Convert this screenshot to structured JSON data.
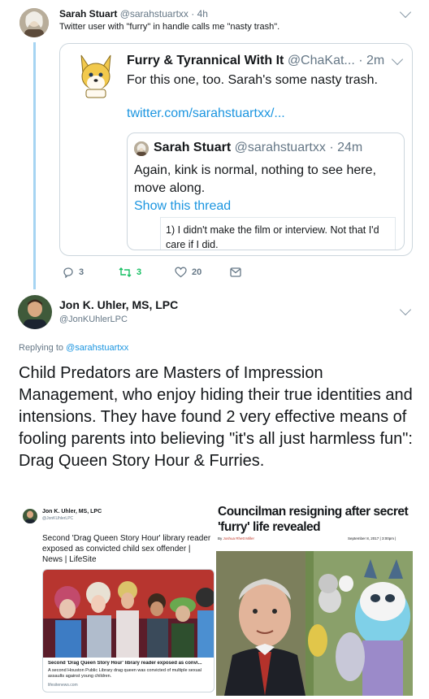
{
  "tweet1": {
    "name": "Sarah Stuart",
    "handle": "@sarahstuartxx",
    "time": "· 4h",
    "text": "Twitter user with \"furry\" in handle calls me \"nasty trash\"."
  },
  "quote": {
    "name": "Furry & Tyrannical With It",
    "handle": "@ChaKat...",
    "time": "· 2m",
    "text": "For this one, too. Sarah's some nasty trash.",
    "link": "twitter.com/sarahstuartxx/..."
  },
  "inner_quote": {
    "name": "Sarah Stuart",
    "handle": "@sarahstuartxx",
    "time": "· 24m",
    "text": "Again, kink is normal, nothing to see here, move along.",
    "show_thread": "Show this thread",
    "preview_text": "1) I didn't make the film or interview. Not that I'd care if I did."
  },
  "actions": {
    "replies": "3",
    "retweets": "3",
    "likes": "20"
  },
  "tweet2": {
    "name": "Jon K. Uhler, MS, LPC",
    "handle": "@JonKUhlerLPC",
    "replying_prefix": "Replying to",
    "replying_to": "@sarahstuartxx",
    "text": "Child Predators are Masters of Impression Management, who enjoy hiding their true identities and intensions. They have found 2 very effective means of fooling parents into believing \"it's all just harmless fun\": Drag Queen Story Hour & Furries."
  },
  "image_left": {
    "name": "Jon K. Uhler, MS, LPC",
    "handle": "@JonKUhlerLPC",
    "text": "Second 'Drag Queen Story Hour' library reader exposed as convicted child sex offender | News | LifeSite",
    "card_title": "Second 'Drag Queen Story Hour' library reader exposed as convi...",
    "card_desc": "A second Houston Public Library drag queen was convicted of multiple sexual assaults against young children.",
    "card_domain": "lifesitenews.com"
  },
  "image_right": {
    "headline": "Councilman resigning after secret 'furry' life revealed",
    "byline_prefix": "By",
    "byline": "Joshua Rhett Miller",
    "date": "September 8, 2017 | 3:00pm |"
  },
  "colors": {
    "accent": "#1b95e0",
    "retweet_green": "#17bf63",
    "thread_line": "#a6d4f2",
    "border": "#ccd6dd"
  }
}
